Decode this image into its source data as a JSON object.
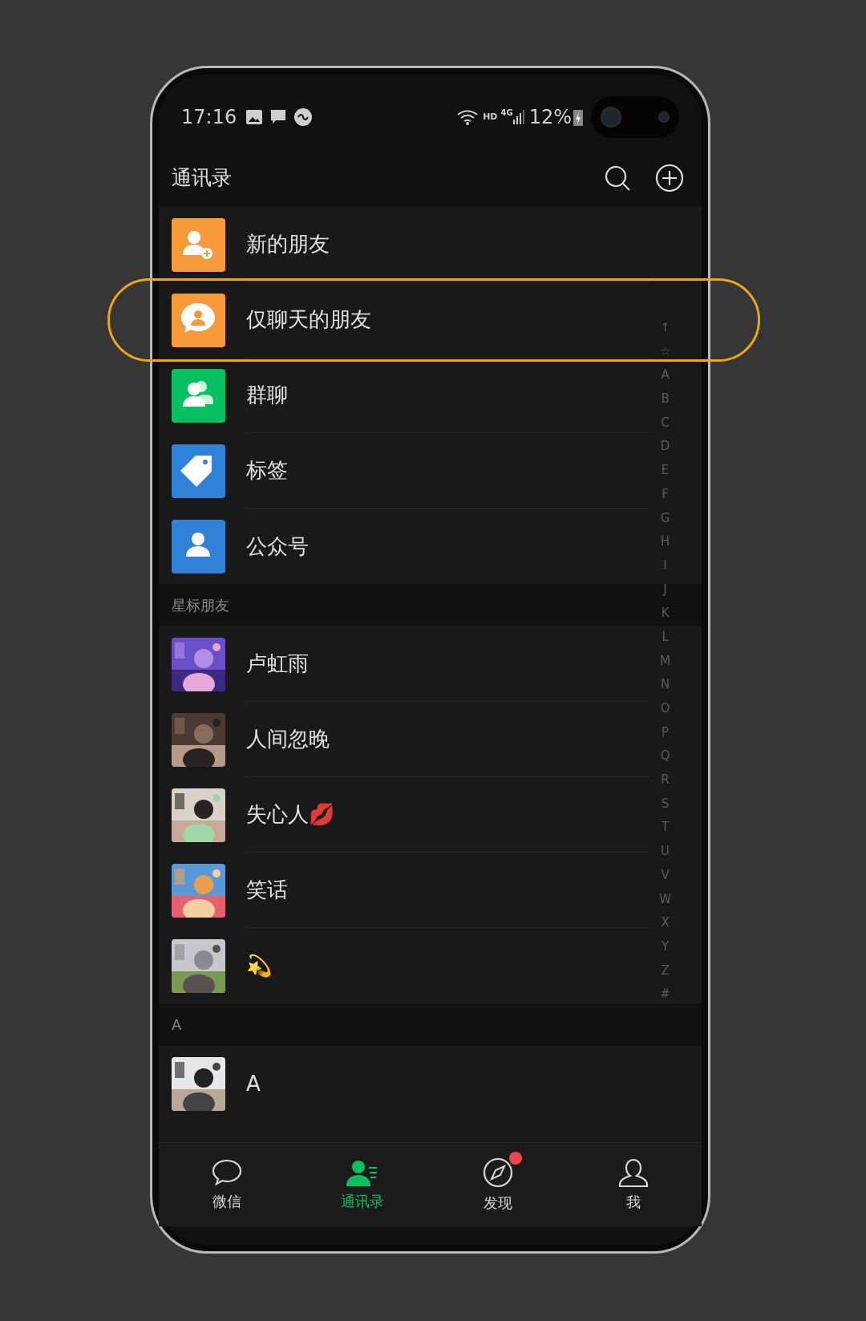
{
  "status_bar": {
    "time": "17:16",
    "network": "HD",
    "generation": "4G",
    "battery": "12%"
  },
  "header": {
    "title": "通讯录"
  },
  "features": [
    {
      "kind": "new-friend",
      "label": "新的朋友",
      "highlighted": false
    },
    {
      "kind": "chat-only",
      "label": "仅聊天的朋友",
      "highlighted": true
    },
    {
      "kind": "group",
      "label": "群聊",
      "highlighted": false
    },
    {
      "kind": "tag",
      "label": "标签",
      "highlighted": false
    },
    {
      "kind": "official",
      "label": "公众号",
      "highlighted": false
    }
  ],
  "sections": [
    {
      "title": "星标朋友",
      "contacts": [
        {
          "name": "卢虹雨"
        },
        {
          "name": "人间忽晚"
        },
        {
          "name": "失心人💋"
        },
        {
          "name": "笑话"
        },
        {
          "name": "💫"
        }
      ]
    },
    {
      "title": "A",
      "contacts": [
        {
          "name": "A"
        }
      ]
    }
  ],
  "index_bar": [
    "↑",
    "☆",
    "A",
    "B",
    "C",
    "D",
    "E",
    "F",
    "G",
    "H",
    "I",
    "J",
    "K",
    "L",
    "M",
    "N",
    "O",
    "P",
    "Q",
    "R",
    "S",
    "T",
    "U",
    "V",
    "W",
    "X",
    "Y",
    "Z",
    "#"
  ],
  "tab_bar": [
    {
      "kind": "chats",
      "label": "微信",
      "selected": false,
      "dot": false
    },
    {
      "kind": "contacts",
      "label": "通讯录",
      "selected": true,
      "dot": false
    },
    {
      "kind": "discover",
      "label": "发现",
      "selected": false,
      "dot": true
    },
    {
      "kind": "me",
      "label": "我",
      "selected": false,
      "dot": false
    }
  ]
}
